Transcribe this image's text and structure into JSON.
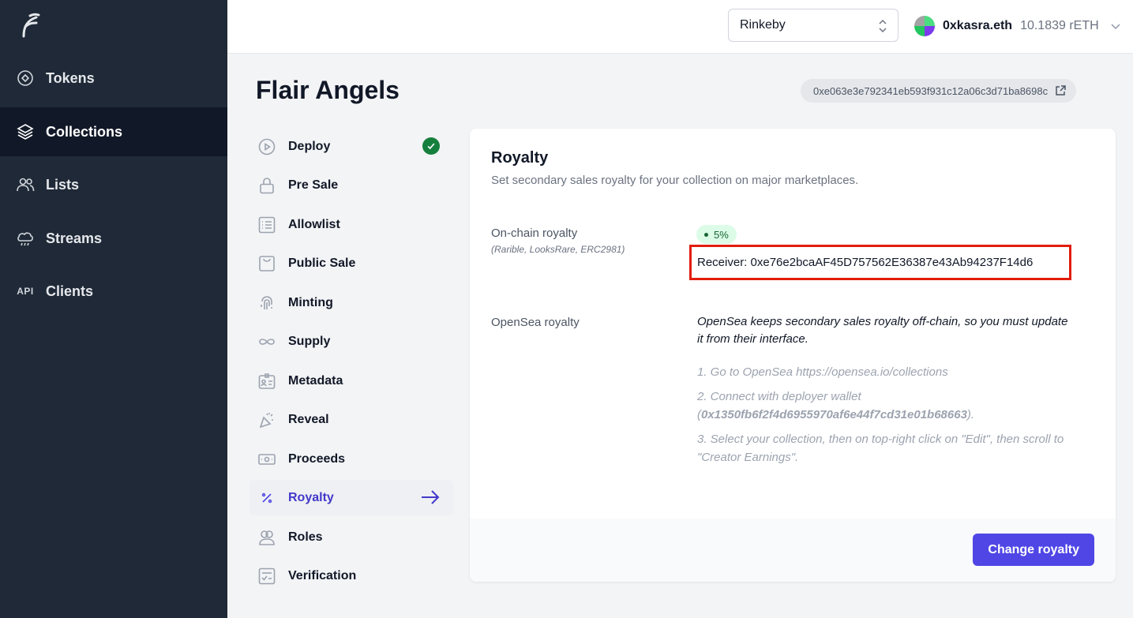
{
  "sidebar": {
    "items": [
      {
        "label": "Tokens",
        "icon": "tokens-icon"
      },
      {
        "label": "Collections",
        "icon": "layers-icon",
        "active": true
      },
      {
        "label": "Lists",
        "icon": "users-icon"
      },
      {
        "label": "Streams",
        "icon": "cloud-rain-icon"
      },
      {
        "label": "Clients",
        "icon": "api-icon",
        "icon_text": "API"
      }
    ]
  },
  "topbar": {
    "network": "Rinkeby",
    "account_name": "0xkasra.eth",
    "balance": "10.1839 rETH"
  },
  "page": {
    "title": "Flair Angels",
    "contract_address": "0xe063e3e792341eb593f931c12a06c3d71ba8698c"
  },
  "steps": [
    {
      "label": "Deploy",
      "icon": "play-circle-icon",
      "done": true
    },
    {
      "label": "Pre Sale",
      "icon": "lock-icon"
    },
    {
      "label": "Allowlist",
      "icon": "list-icon"
    },
    {
      "label": "Public Sale",
      "icon": "shopping-bag-icon"
    },
    {
      "label": "Minting",
      "icon": "fingerprint-icon"
    },
    {
      "label": "Supply",
      "icon": "infinity-icon"
    },
    {
      "label": "Metadata",
      "icon": "id-card-icon"
    },
    {
      "label": "Reveal",
      "icon": "party-icon"
    },
    {
      "label": "Proceeds",
      "icon": "cash-icon"
    },
    {
      "label": "Royalty",
      "icon": "percent-icon",
      "active": true
    },
    {
      "label": "Roles",
      "icon": "user-group-icon"
    },
    {
      "label": "Verification",
      "icon": "checklist-icon"
    }
  ],
  "card": {
    "title": "Royalty",
    "description": "Set secondary sales royalty for your collection on major marketplaces.",
    "onchain_label": "On-chain royalty",
    "onchain_sub": "(Rarible, LooksRare, ERC2981)",
    "onchain_percent": "5%",
    "receiver": "Receiver: 0xe76e2bcaAF45D757562E36387e43Ab94237F14d6",
    "opensea_label": "OpenSea royalty",
    "opensea_note": "OpenSea keeps secondary sales royalty off-chain, so you must update it from their interface.",
    "opensea_step1": "1. Go to OpenSea https://opensea.io/collections",
    "opensea_step2_prefix": "2. Connect with deployer wallet (",
    "opensea_step2_wallet": "0x1350fb6f2f4d6955970af6e44f7cd31e01b68663",
    "opensea_step2_suffix": ").",
    "opensea_step3": "3. Select your collection, then on top-right click on \"Edit\", then scroll to \"Creator Earnings\".",
    "button": "Change royalty"
  },
  "colors": {
    "sidebar_bg": "#1f2937",
    "accent": "#4f46e5",
    "success": "#15803d",
    "highlight_border": "#e11d0a"
  }
}
